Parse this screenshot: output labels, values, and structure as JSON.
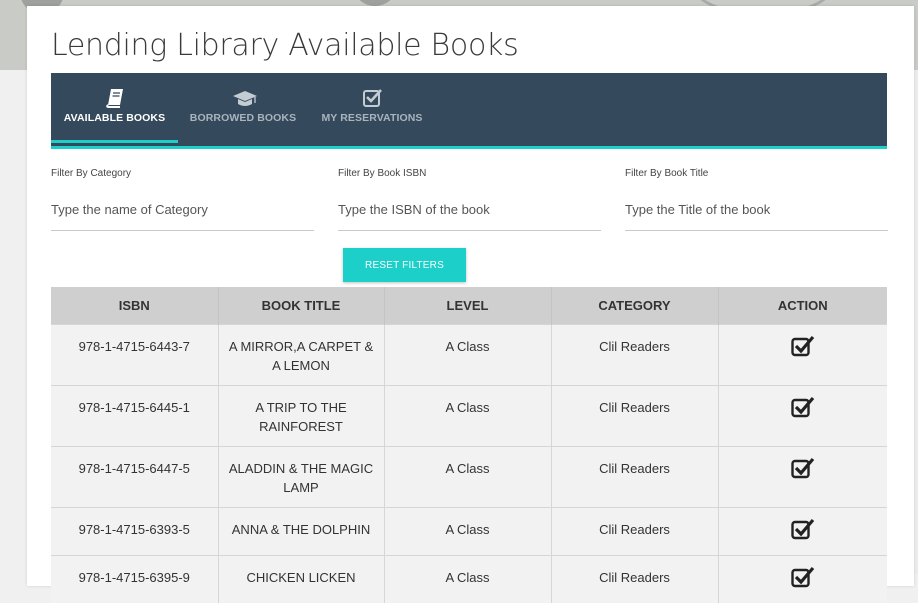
{
  "page": {
    "title": "Lending Library Available Books"
  },
  "tabs": [
    {
      "label": "AVAILABLE BOOKS",
      "icon": "book-icon",
      "active": true
    },
    {
      "label": "BORROWED BOOKS",
      "icon": "graduation-cap-icon",
      "active": false
    },
    {
      "label": "MY RESERVATIONS",
      "icon": "checkbox-icon",
      "active": false
    }
  ],
  "filters": {
    "category": {
      "label": "Filter By Category",
      "placeholder": "Type the name of Category"
    },
    "isbn": {
      "label": "Filter By Book ISBN",
      "placeholder": "Type the ISBN of the book"
    },
    "title": {
      "label": "Filter By Book Title",
      "placeholder": "Type the Title of the book"
    }
  },
  "reset_button": {
    "label": "RESET FILTERS"
  },
  "table": {
    "columns": [
      "ISBN",
      "BOOK TITLE",
      "LEVEL",
      "CATEGORY",
      "ACTION"
    ],
    "rows": [
      {
        "isbn": "978-1-4715-6443-7",
        "title": "A MIRROR,A CARPET & A LEMON",
        "level": "A Class",
        "category": "Clil Readers"
      },
      {
        "isbn": "978-1-4715-6445-1",
        "title": "A TRIP TO THE RAINFOREST",
        "level": "A Class",
        "category": "Clil Readers"
      },
      {
        "isbn": "978-1-4715-6447-5",
        "title": "ALADDIN & THE MAGIC LAMP",
        "level": "A Class",
        "category": "Clil Readers"
      },
      {
        "isbn": "978-1-4715-6393-5",
        "title": "ANNA & THE DOLPHIN",
        "level": "A Class",
        "category": "Clil Readers"
      },
      {
        "isbn": "978-1-4715-6395-9",
        "title": "CHICKEN LICKEN",
        "level": "A Class",
        "category": "Clil Readers"
      }
    ]
  },
  "colors": {
    "tabbar": "#34495b",
    "accent": "#1ccfc9",
    "header_row": "#cfcfcf",
    "row_bg": "#f2f2f2"
  }
}
